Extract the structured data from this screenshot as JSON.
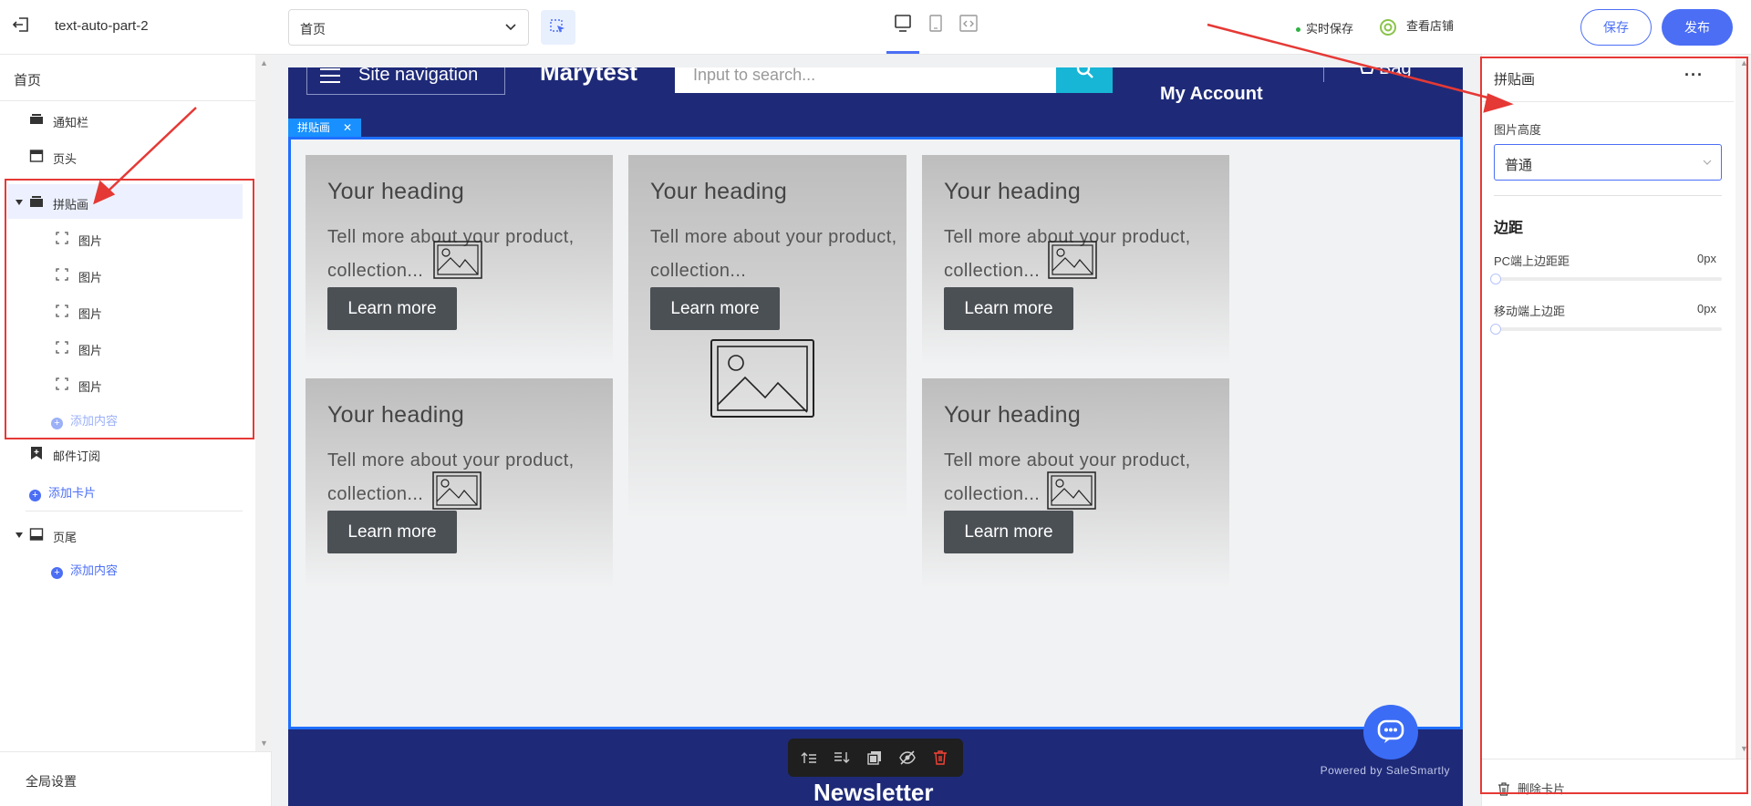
{
  "topbar": {
    "app_title": "text-auto-part-2",
    "page_select_value": "首页",
    "autosave_label": "实时保存",
    "view_store_label": "查看店铺",
    "save_label": "保存",
    "publish_label": "发布"
  },
  "sidebar": {
    "page_title": "首页",
    "items": [
      {
        "label": "通知栏",
        "icon": "bar-icon"
      },
      {
        "label": "页头",
        "icon": "header-icon"
      },
      {
        "label": "拼贴画",
        "icon": "collage-icon",
        "selected": true
      },
      {
        "label": "图片",
        "icon": "image-icon"
      },
      {
        "label": "图片",
        "icon": "image-icon"
      },
      {
        "label": "图片",
        "icon": "image-icon"
      },
      {
        "label": "图片",
        "icon": "image-icon"
      },
      {
        "label": "图片",
        "icon": "image-icon"
      },
      {
        "label": "邮件订阅",
        "icon": "bookmark-icon"
      },
      {
        "label": "页尾",
        "icon": "footer-icon"
      }
    ],
    "add_content_label": "添加内容",
    "add_card_label": "添加卡片",
    "footer_add_content_label": "添加内容",
    "global_settings_label": "全局设置"
  },
  "canvas": {
    "nav_label": "Site navigation",
    "brand": "Marytest",
    "search_placeholder": "Input to search...",
    "account_label": "My Account",
    "bag_label": "Bag",
    "section_tag": "拼贴画",
    "cards": [
      {
        "heading": "Your heading",
        "text": "Tell more about your product, collection...",
        "button": "Learn more"
      },
      {
        "heading": "Your heading",
        "text": "Tell more about your product, collection...",
        "button": "Learn more"
      },
      {
        "heading": "Your heading",
        "text": "Tell more about your product, collection...",
        "button": "Learn more"
      },
      {
        "heading": "Your heading",
        "text": "Tell more about your product, collection...",
        "button": "Learn more"
      },
      {
        "heading": "Your heading",
        "text": "Tell more about your product, collection...",
        "button": "Learn more"
      }
    ],
    "newsletter_title": "Newsletter",
    "powered_by": "Powered by SaleSmartly"
  },
  "right_panel": {
    "title": "拼贴画",
    "more_label": "···",
    "image_height_label": "图片高度",
    "image_height_value": "普通",
    "spacing_heading": "边距",
    "pc_top_margin_label": "PC端上边距距",
    "pc_top_margin_value": "0px",
    "mobile_top_margin_label": "移动端上边距",
    "mobile_top_margin_value": "0px",
    "delete_card_label": "删除卡片"
  },
  "colors": {
    "accent": "#4b6ef5",
    "site_header": "#1e2a78",
    "annotation_red": "#e53935",
    "selection_blue": "#1e6fff"
  }
}
